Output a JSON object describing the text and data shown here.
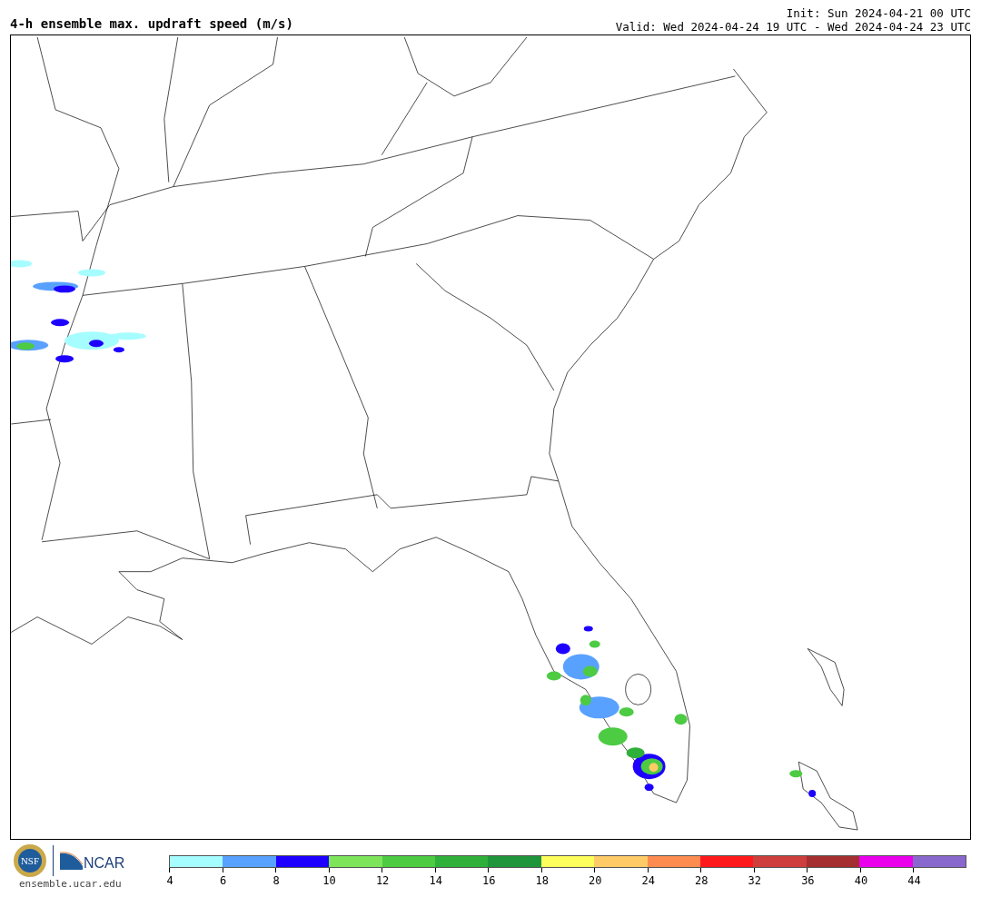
{
  "title": "4-h ensemble max. updraft speed (m/s)",
  "init": "Init: Sun 2024-04-21 00 UTC",
  "valid": "Valid: Wed 2024-04-24 19 UTC - Wed 2024-04-24 23 UTC",
  "logos": {
    "nsf": "NSF",
    "ncar": "NCAR"
  },
  "site": "ensemble.ucar.edu",
  "legend": [
    {
      "color": "#a6fdff",
      "label": "4"
    },
    {
      "color": "#59a1ff",
      "label": "6"
    },
    {
      "color": "#1d00ff",
      "label": "8"
    },
    {
      "color": "#7ee55b",
      "label": "10"
    },
    {
      "color": "#4ccb43",
      "label": "12"
    },
    {
      "color": "#2eb03a",
      "label": "14"
    },
    {
      "color": "#1f963c",
      "label": "16"
    },
    {
      "color": "#fdfe5c",
      "label": "18"
    },
    {
      "color": "#fecb67",
      "label": "20"
    },
    {
      "color": "#fe8b4f",
      "label": "24"
    },
    {
      "color": "#fe1a1c",
      "label": "28"
    },
    {
      "color": "#cd3e3d",
      "label": "32"
    },
    {
      "color": "#a52e30",
      "label": "36"
    },
    {
      "color": "#ea00ec",
      "label": "40"
    },
    {
      "color": "#8968cd",
      "label": "44"
    }
  ]
}
